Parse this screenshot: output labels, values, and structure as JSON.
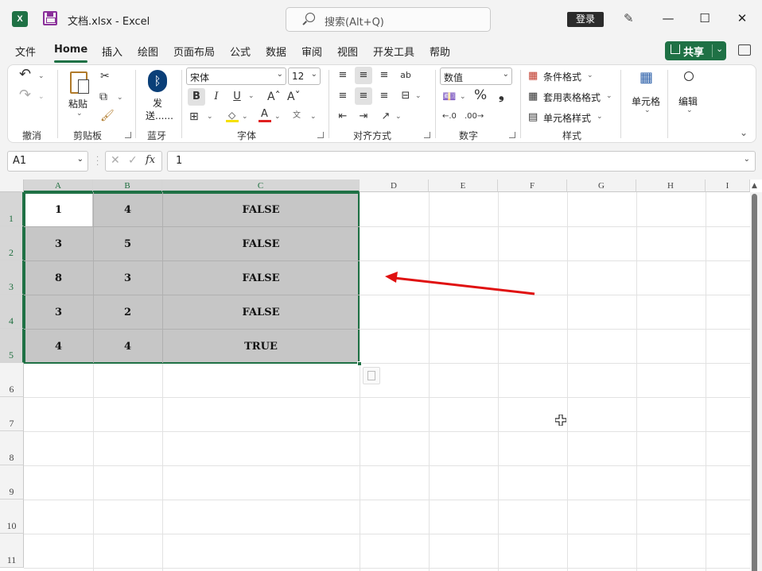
{
  "titlebar": {
    "app_icon_letter": "X",
    "doc_title": "文档.xlsx  -  Excel",
    "search_placeholder": "搜索(Alt+Q)",
    "login_label": "登录",
    "pen_glyph": "✎",
    "min_glyph": "—",
    "max_glyph": "☐",
    "close_glyph": "✕"
  },
  "menu": {
    "items": [
      "文件",
      "Home",
      "插入",
      "绘图",
      "页面布局",
      "公式",
      "数据",
      "审阅",
      "视图",
      "开发工具",
      "帮助"
    ],
    "share_label": "共享",
    "share_arrow": "⌄"
  },
  "ribbon": {
    "undo_group": "撤消",
    "clipboard_group": "剪贴板",
    "paste_label": "粘贴",
    "bluetooth_label_1": "发",
    "bluetooth_label_2": "送......",
    "bluetooth_group": "蓝牙",
    "font_name": "宋体",
    "font_size": "12",
    "bold": "B",
    "italic": "I",
    "underline": "U",
    "font_group": "字体",
    "align_group": "对齐方式",
    "number_format": "数值",
    "number_group": "数字",
    "percent": "%",
    "comma": "❟",
    "cond_format": "条件格式",
    "table_format": "套用表格格式",
    "cell_style": "单元格样式",
    "style_group": "样式",
    "cells_label": "单元格",
    "edit_label": "编辑",
    "font_color": "#e02020",
    "fill_color": "#f5e000"
  },
  "formula_bar": {
    "name_box": "A1",
    "fx": "fx",
    "value": "1"
  },
  "sheet": {
    "columns": [
      "A",
      "B",
      "C",
      "D",
      "E",
      "F",
      "G",
      "H",
      "I"
    ],
    "rows": [
      "1",
      "2",
      "3",
      "4",
      "5",
      "6",
      "7",
      "8",
      "9",
      "10",
      "11"
    ],
    "data": [
      [
        "1",
        "4",
        "FALSE"
      ],
      [
        "3",
        "5",
        "FALSE"
      ],
      [
        "8",
        "3",
        "FALSE"
      ],
      [
        "3",
        "2",
        "FALSE"
      ],
      [
        "4",
        "4",
        "TRUE"
      ]
    ],
    "arrow_color": "#e01010"
  }
}
